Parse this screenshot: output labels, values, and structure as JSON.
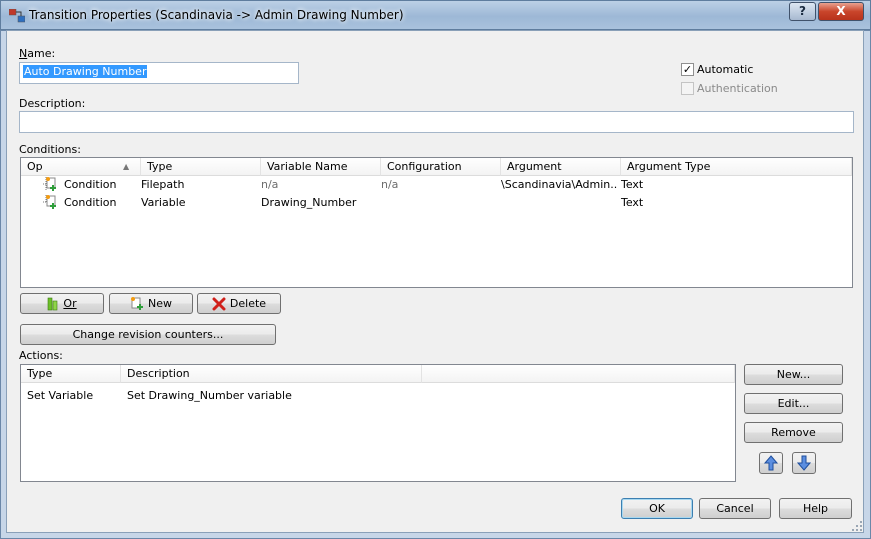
{
  "window": {
    "title": "Transition Properties (Scandinavia -> Admin Drawing Number)",
    "help_glyph": "?",
    "close_glyph": "X"
  },
  "name": {
    "label": "Name:",
    "value": "Auto Drawing Number"
  },
  "description": {
    "label": "Description:",
    "value": ""
  },
  "automatic": {
    "label": "Automatic",
    "checked": true,
    "check_glyph": "✓"
  },
  "authentication": {
    "label": "Authentication",
    "checked": false,
    "disabled": true
  },
  "conditions": {
    "label": "Conditions:",
    "columns": [
      "Op",
      "Type",
      "Variable Name",
      "Configuration",
      "Argument",
      "Argument Type"
    ],
    "sort_glyph": "▲",
    "rows": [
      {
        "op": "Condition",
        "type": "Filepath",
        "variable": "n/a",
        "configuration": "n/a",
        "argument": "\\Scandinavia\\Admin..",
        "argument_type": "Text"
      },
      {
        "op": "Condition",
        "type": "Variable",
        "variable": "Drawing_Number",
        "configuration": "",
        "argument": "",
        "argument_type": "Text"
      }
    ],
    "buttons": {
      "or": "Or",
      "new": "New",
      "delete": "Delete"
    }
  },
  "change_revision_counters": "Change revision counters...",
  "actions": {
    "label": "Actions:",
    "columns": [
      "Type",
      "Description"
    ],
    "rows": [
      {
        "type": "Set Variable",
        "description": "Set Drawing_Number variable"
      }
    ],
    "buttons": {
      "new": "New...",
      "edit": "Edit...",
      "remove": "Remove"
    }
  },
  "footer": {
    "ok": "OK",
    "cancel": "Cancel",
    "help": "Help"
  },
  "colors": {
    "selection": "#3399ff",
    "title_gradient": "#9db8d6"
  }
}
